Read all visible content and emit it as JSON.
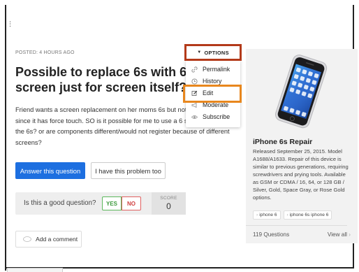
{
  "question": {
    "posted": "POSTED: 4 HOURS AGO",
    "title": "Possible to replace 6s with 6 screen just for screen itself?",
    "body": "Friend wants a screen replacement on her moms 6s but not 6s screens since it has force touch. SO is it possible for me to use a 6 screen to replace the 6s? or are components different/would not register because of different screens?"
  },
  "actions": {
    "answer_label": "Answer this question",
    "same_problem_label": "I have this problem too"
  },
  "vote": {
    "prompt": "Is this a good question?",
    "yes_label": "YES",
    "no_label": "NO",
    "score_label": "SCORE",
    "score_value": "0"
  },
  "comment": {
    "add_label": "Add a comment"
  },
  "options": {
    "button_label": "OPTIONS",
    "items": [
      {
        "label": "Permalink",
        "icon": "link-icon"
      },
      {
        "label": "History",
        "icon": "clock-icon"
      },
      {
        "label": "Edit",
        "icon": "pencil-icon"
      },
      {
        "label": "Moderate",
        "icon": "megaphone-icon"
      },
      {
        "label": "Subscribe",
        "icon": "eye-icon"
      }
    ],
    "highlight_color": "#b33a1a",
    "edit_highlight_color": "#e8871e"
  },
  "sidebar": {
    "product_title": "iPhone 6s Repair",
    "description": "Released September 25, 2015. Model A1688/A1633. Repair of this device is similar to previous generations, requiring screwdrivers and prying tools. Available as GSM or CDMA / 16, 64, or 128 GB / Silver, Gold, Space Gray, or Rose Gold options.",
    "tags": [
      "iphone 6",
      "iphone 6s iphone 6"
    ],
    "questions_count": "119 Questions",
    "view_all": "View all"
  },
  "colors": {
    "primary": "#1d6fe0",
    "yes": "#3d9a3d",
    "no": "#d04040"
  }
}
